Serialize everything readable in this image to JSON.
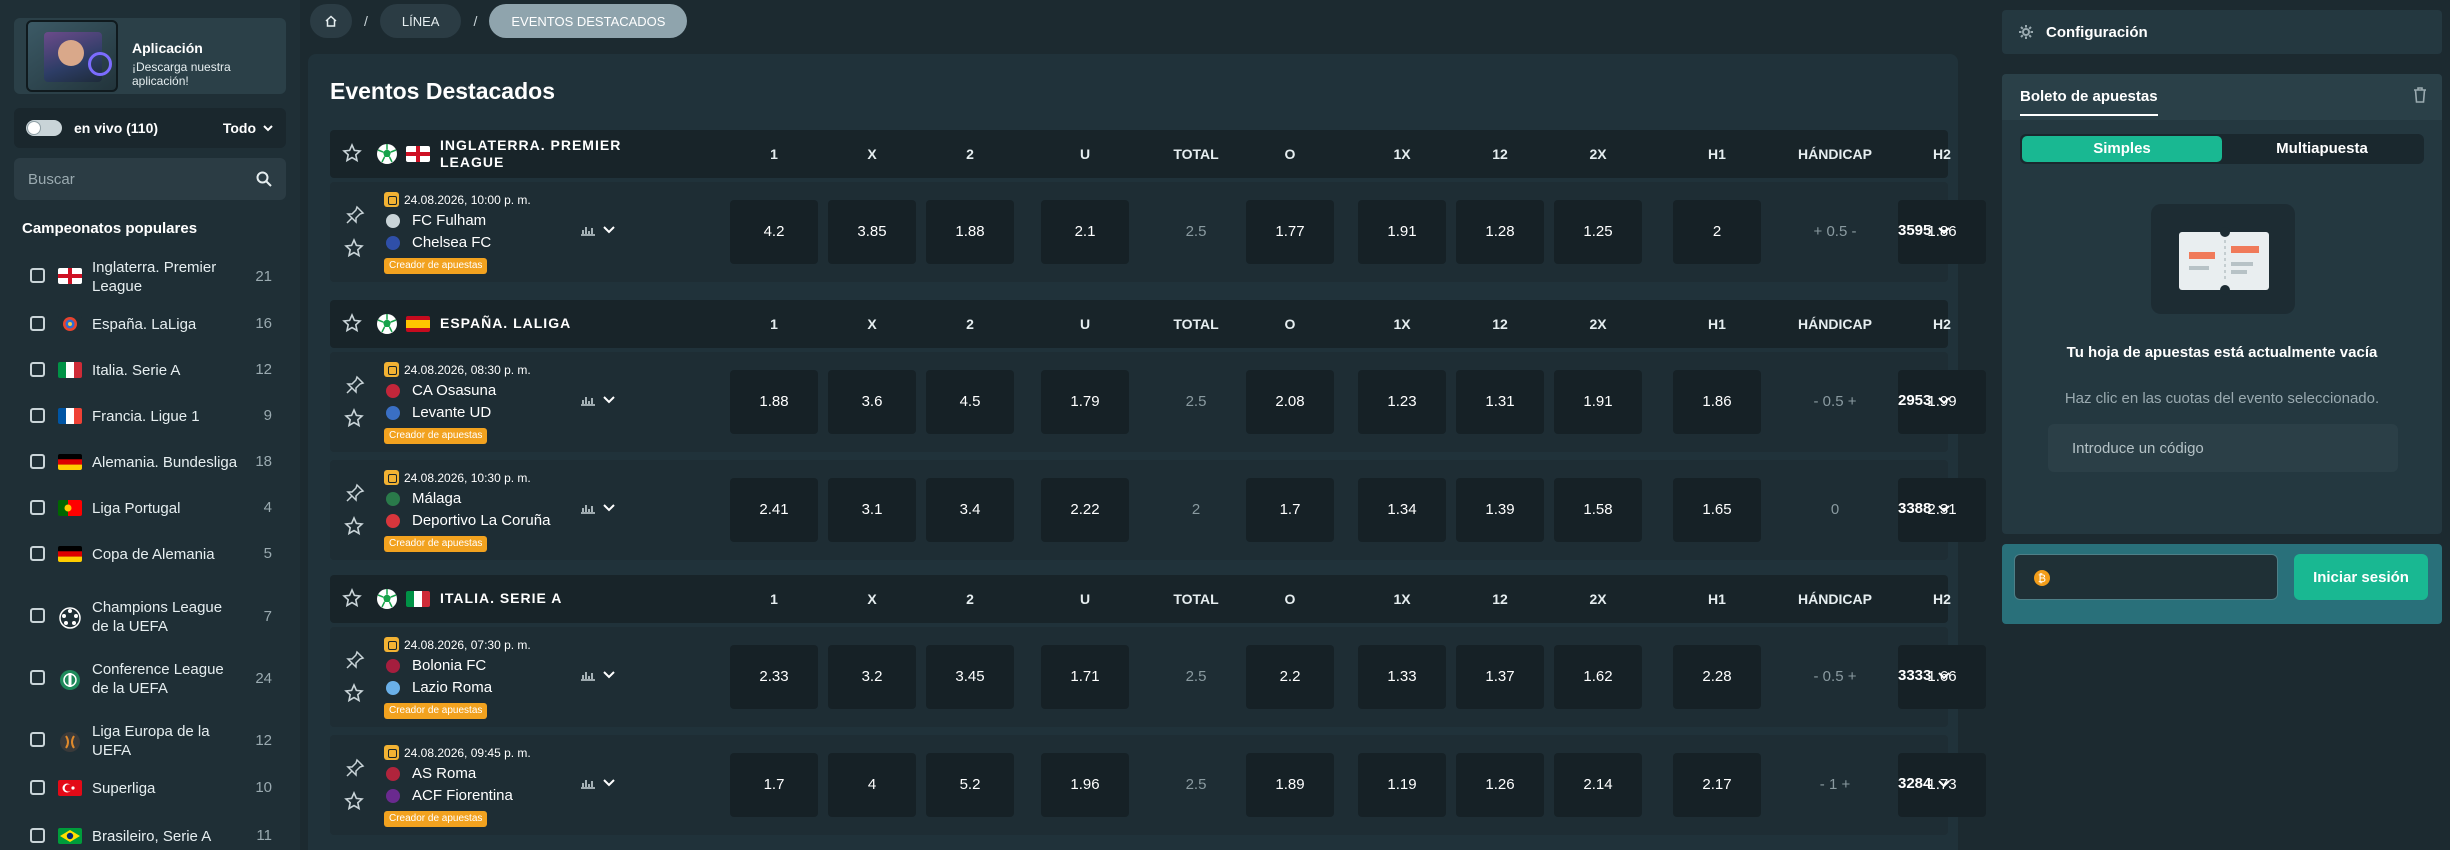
{
  "sidebar": {
    "app_banner": {
      "title": "Aplicación",
      "subtitle": "¡Descarga nuestra aplicación!"
    },
    "live": {
      "label": "en vivo (110)",
      "filter": "Todo"
    },
    "search": {
      "placeholder": "Buscar"
    },
    "popular_title": "Campeonatos populares",
    "leagues": [
      {
        "name": "Inglaterra. Premier League",
        "count": "21",
        "flag": "england"
      },
      {
        "name": "España. LaLiga",
        "count": "16",
        "flag": "laliga"
      },
      {
        "name": "Italia. Serie A",
        "count": "12",
        "flag": "italy"
      },
      {
        "name": "Francia. Ligue 1",
        "count": "9",
        "flag": "france"
      },
      {
        "name": "Alemania. Bundesliga",
        "count": "18",
        "flag": "germany"
      },
      {
        "name": "Liga Portugal",
        "count": "4",
        "flag": "portugal"
      },
      {
        "name": "Copa de Alemania",
        "count": "5",
        "flag": "germany"
      },
      {
        "name": "Champions League de la UEFA",
        "count": "7",
        "flag": "ucl"
      },
      {
        "name": "Conference League de la UEFA",
        "count": "24",
        "flag": "uecl"
      },
      {
        "name": "Liga Europa de la UEFA",
        "count": "12",
        "flag": "uel"
      },
      {
        "name": "Superliga",
        "count": "10",
        "flag": "turkey"
      },
      {
        "name": "Brasileiro, Serie A",
        "count": "11",
        "flag": "brazil"
      }
    ]
  },
  "breadcrumb": {
    "home_icon": "home-icon",
    "items": [
      "LÍNEA",
      "EVENTOS DESTACADOS"
    ]
  },
  "main": {
    "title": "Eventos Destacados",
    "columns": [
      "1",
      "X",
      "2",
      "U",
      "TOTAL",
      "O",
      "1X",
      "12",
      "2X",
      "H1",
      "HÁNDICAP",
      "H2"
    ],
    "creator_label": "Creador de apuestas",
    "groups": [
      {
        "league": "INGLATERRA. PREMIER LEAGUE",
        "flag": "england",
        "events": [
          {
            "date": "24.08.2026, 10:00 p. m.",
            "home": "FC Fulham",
            "away": "Chelsea FC",
            "odds": [
              "4.2",
              "3.85",
              "1.88",
              "2.1",
              "2.5",
              "1.77",
              "1.91",
              "1.28",
              "1.25",
              "2",
              "+ 0.5 -",
              "1.86"
            ],
            "more": "3595"
          }
        ]
      },
      {
        "league": "ESPAÑA. LALIGA",
        "flag": "spain",
        "events": [
          {
            "date": "24.08.2026, 08:30 p. m.",
            "home": "CA Osasuna",
            "away": "Levante UD",
            "odds": [
              "1.88",
              "3.6",
              "4.5",
              "1.79",
              "2.5",
              "2.08",
              "1.23",
              "1.31",
              "1.91",
              "1.86",
              "- 0.5 +",
              "1.99"
            ],
            "more": "2953"
          },
          {
            "date": "24.08.2026, 10:30 p. m.",
            "home": "Málaga",
            "away": "Deportivo La Coruña",
            "odds": [
              "2.41",
              "3.1",
              "3.4",
              "2.22",
              "2",
              "1.7",
              "1.34",
              "1.39",
              "1.58",
              "1.65",
              "0",
              "2.31"
            ],
            "more": "3388"
          }
        ]
      },
      {
        "league": "ITALIA. SERIE A",
        "flag": "italy",
        "events": [
          {
            "date": "24.08.2026, 07:30 p. m.",
            "home": "Bolonia FC",
            "away": "Lazio Roma",
            "odds": [
              "2.33",
              "3.2",
              "3.45",
              "1.71",
              "2.5",
              "2.2",
              "1.33",
              "1.37",
              "1.62",
              "2.28",
              "- 0.5 +",
              "1.66"
            ],
            "more": "3333"
          },
          {
            "date": "24.08.2026, 09:45 p. m.",
            "home": "AS Roma",
            "away": "ACF Fiorentina",
            "odds": [
              "1.7",
              "4",
              "5.2",
              "1.96",
              "2.5",
              "1.89",
              "1.19",
              "1.26",
              "2.14",
              "2.17",
              "- 1 +",
              "1.73"
            ],
            "more": "3284"
          }
        ]
      }
    ]
  },
  "right": {
    "config_label": "Configuración",
    "betslip": {
      "tab_label": "Boleto de apuestas",
      "mode_single": "Simples",
      "mode_multi": "Multiapuesta",
      "empty_title": "Tu hoja de apuestas está actualmente vacía",
      "empty_sub": "Haz clic en las cuotas del evento seleccionado.",
      "code_placeholder": "Introduce un código"
    },
    "login_label": "Iniciar sesión"
  },
  "colors": {
    "accent": "#19b892",
    "creator": "#f2a21f",
    "panel": "#20323a",
    "background": "#1c2a30"
  }
}
